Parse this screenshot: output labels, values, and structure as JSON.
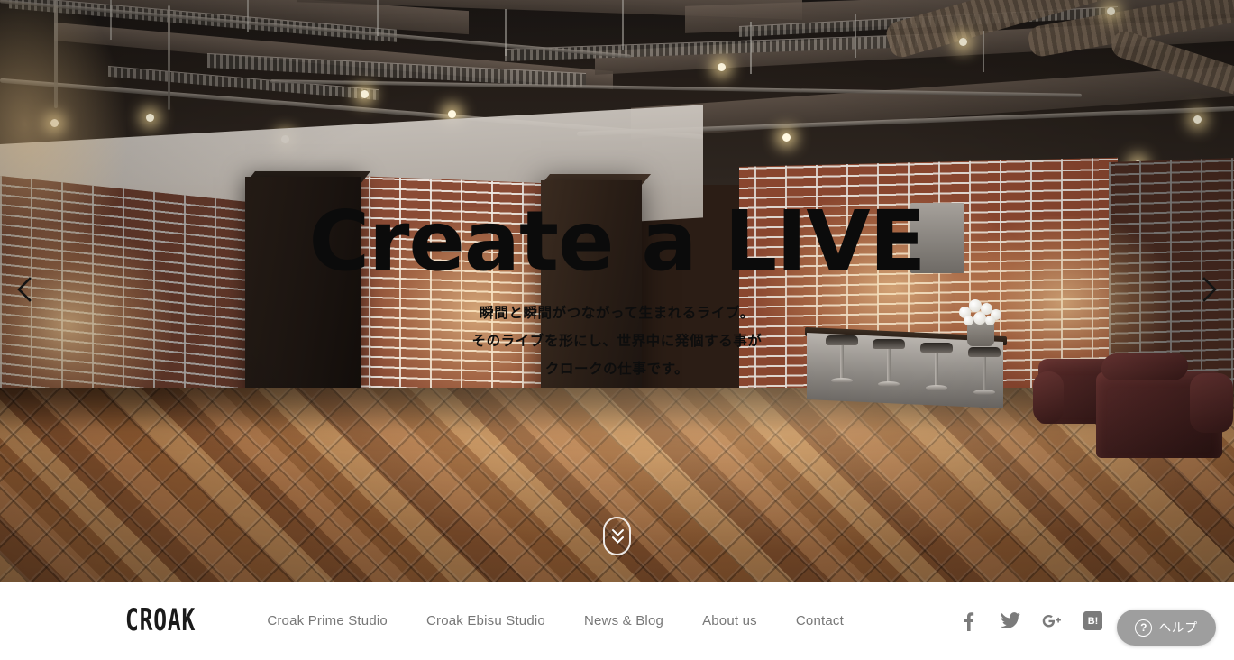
{
  "hero": {
    "title": "Create a LIVE",
    "subtitle_lines": [
      "瞬間と瞬間がつながって生まれるライブ。",
      "そのライブを形にし、世界中に発個する事が",
      "クロークの仕事です。"
    ],
    "prev_arrow_icon": "chevron-left-icon",
    "next_arrow_icon": "chevron-right-icon",
    "scroll_indicator_icon": "double-chevron-down-icon",
    "title_color": "#0b0b0b"
  },
  "navbar": {
    "logo": "CROAK",
    "links": [
      {
        "label": "Croak Prime Studio"
      },
      {
        "label": "Croak Ebisu Studio"
      },
      {
        "label": "News & Blog"
      },
      {
        "label": "About us"
      },
      {
        "label": "Contact"
      }
    ],
    "link_color": "#777777",
    "background": "#ffffff",
    "social": [
      {
        "name": "facebook",
        "glyph": "f"
      },
      {
        "name": "twitter",
        "glyph": "twitter-bird"
      },
      {
        "name": "google-plus",
        "glyph": "g+"
      },
      {
        "name": "hatena-bookmark",
        "glyph": "B!"
      }
    ]
  },
  "help_widget": {
    "label": "ヘルプ",
    "icon": "question-mark-circle-icon",
    "background": "#9e9e9e"
  }
}
